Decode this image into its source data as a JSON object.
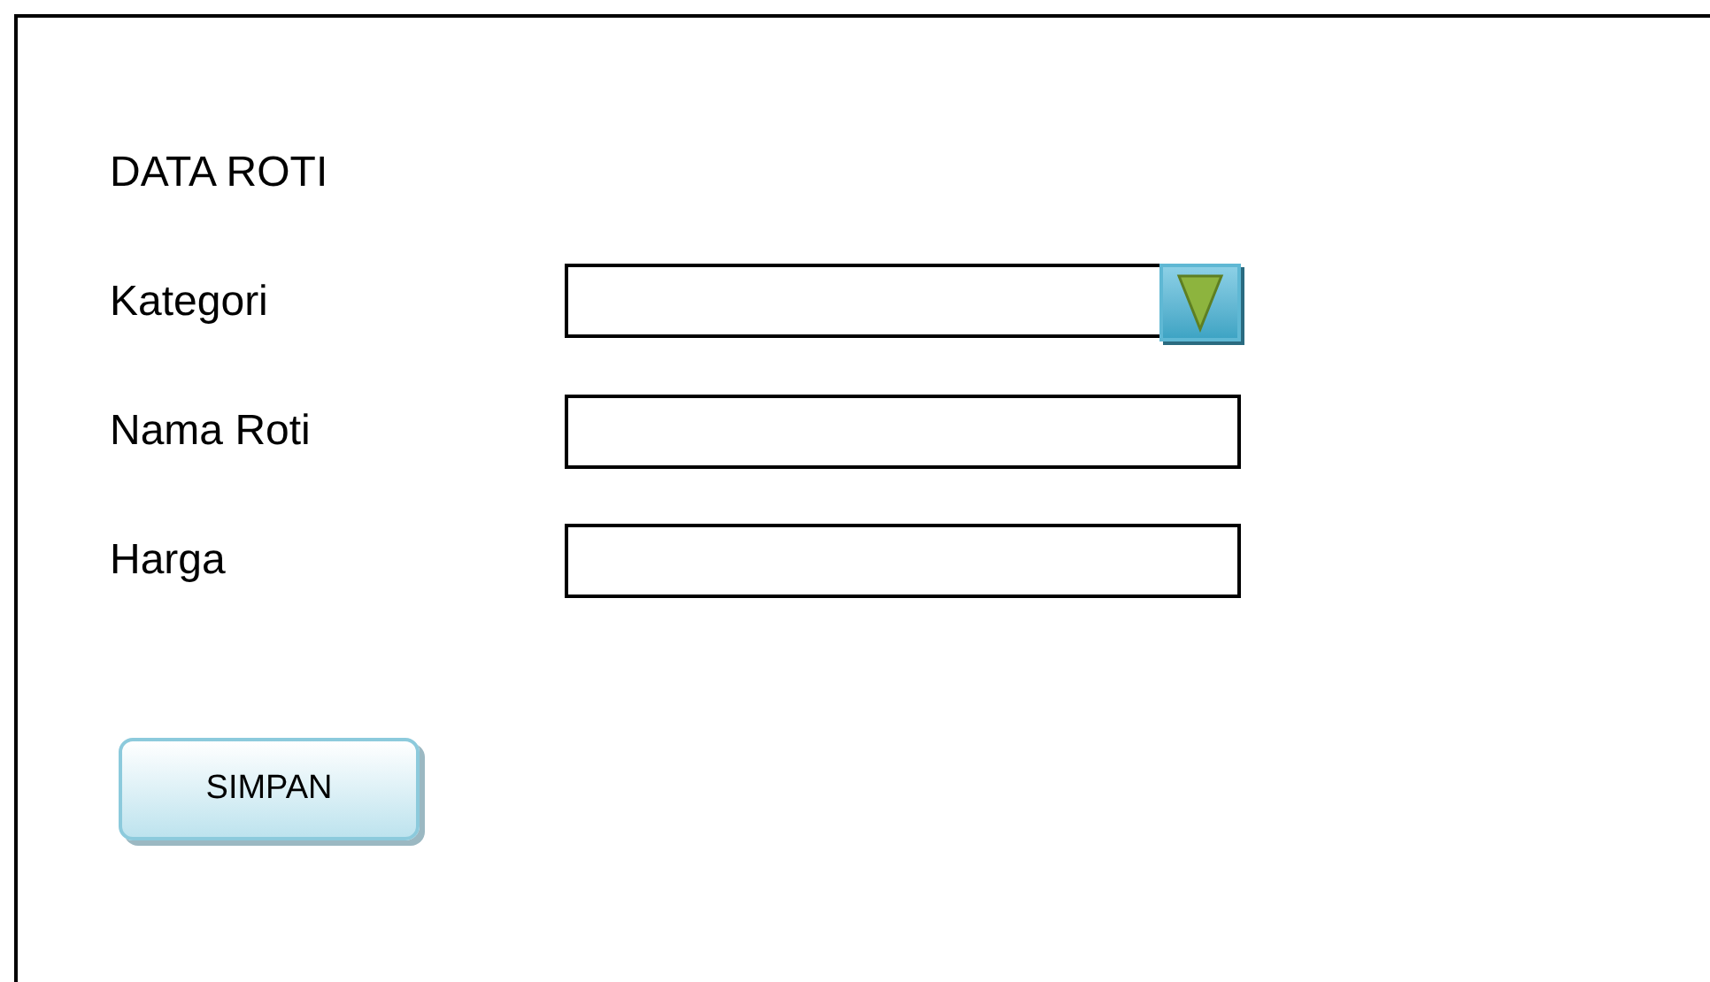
{
  "title": "DATA ROTI",
  "fields": [
    {
      "label": "Kategori",
      "kind": "dropdown"
    },
    {
      "label": "Nama Roti",
      "kind": "text"
    },
    {
      "label": "Harga",
      "kind": "text"
    }
  ],
  "button": {
    "label": "SIMPAN"
  }
}
